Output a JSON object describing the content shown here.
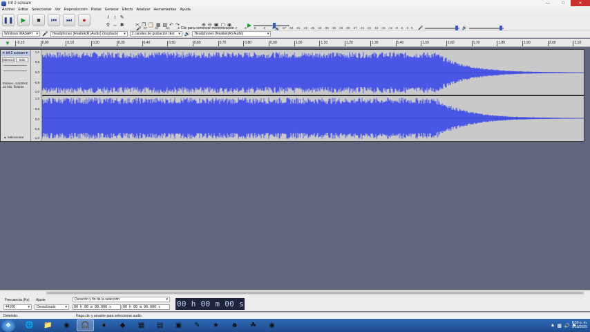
{
  "window": {
    "title": "trif 2 scream"
  },
  "menu": [
    "Archivo",
    "Editar",
    "Seleccionar",
    "Ver",
    "Reproducción",
    "Pistas",
    "Generar",
    "Efecto",
    "Analizar",
    "Herramientas",
    "Ayuda"
  ],
  "meters": {
    "hint": "Clic para comenzar monitorización",
    "rec_scale": [
      "-57",
      "-54",
      "-51",
      "-48",
      "-45",
      "-42",
      "-18",
      "-15",
      "-12",
      "-9",
      "-6",
      "-3",
      "0"
    ],
    "play_scale": [
      "-57",
      "-54",
      "-51",
      "-48",
      "-45",
      "-42",
      "-39",
      "-36",
      "-33",
      "-30",
      "-27",
      "-24",
      "-21",
      "-18",
      "-15",
      "-12",
      "-9",
      "-6",
      "-3",
      "0"
    ]
  },
  "devices": {
    "host": "Windows WASAPI",
    "rec_device": "Headphones (Realtek(R) Audio) (loopback)",
    "channels": "2 canales de grabación (Est",
    "play_device": "Headphones (Realtek(R) Audio)"
  },
  "ruler": [
    "-0,10",
    "0,00",
    "0,10",
    "0,20",
    "0,30",
    "0,40",
    "0,50",
    "0,60",
    "0,70",
    "0,80",
    "0,90",
    "1,00",
    "1,10",
    "1,20",
    "1,30",
    "1,40",
    "1,50",
    "1,60",
    "1,70",
    "1,80",
    "1,90",
    "2,00",
    "2,10"
  ],
  "track": {
    "name": "trif 2 scream",
    "silence": "Silencio",
    "solo": "Solo",
    "info": "Estéreo, 44100Hz 32 bits, flotante",
    "select": "Seleccionar",
    "vscale": [
      "1,0",
      "0,5",
      "0,0",
      "-0,5",
      "-1,0"
    ]
  },
  "selection": {
    "rate_label": "Frecuencia (Hz)",
    "rate_value": "44100",
    "snap_label": "Ajuste",
    "snap_value": "Desactivado",
    "mode": "Duración y fin de la selección",
    "start": "00 h 00 m 00.000 s",
    "end": "00 h 00 m 00.000 s",
    "audio_position": "00 h 00 m 00 s"
  },
  "status": {
    "state": "Detenido.",
    "hint": "Haga clic y arrastre para seleccionar audio"
  },
  "clock": {
    "time": "8:59 p. m.",
    "date": "3/10/2025"
  },
  "colors": {
    "waveform": "#4a56e6",
    "waveform_dark": "#2f39b8",
    "background": "#62657e"
  }
}
